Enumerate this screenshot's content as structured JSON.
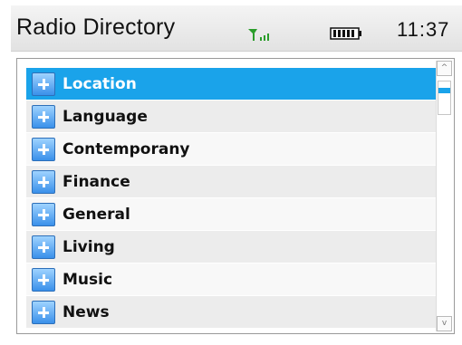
{
  "status_bar": {
    "title": "Radio Directory",
    "signal_icon": "signal-strength-icon",
    "battery_icon": "battery-icon",
    "time": "11:37",
    "signal_color": "#2a9d2a"
  },
  "list": {
    "selected_index": 0,
    "accent_color": "#1aa3ea",
    "items": [
      {
        "label": "Location",
        "icon": "plus-expand-icon"
      },
      {
        "label": "Language",
        "icon": "plus-expand-icon"
      },
      {
        "label": "Contemporany",
        "icon": "plus-expand-icon"
      },
      {
        "label": "Finance",
        "icon": "plus-expand-icon"
      },
      {
        "label": "General",
        "icon": "plus-expand-icon"
      },
      {
        "label": "Living",
        "icon": "plus-expand-icon"
      },
      {
        "label": "Music",
        "icon": "plus-expand-icon"
      },
      {
        "label": "News",
        "icon": "plus-expand-icon"
      }
    ]
  },
  "scrollbar": {
    "up_icon": "scroll-up-arrow-icon",
    "down_icon": "scroll-down-arrow-icon",
    "up_glyph": "^",
    "down_glyph": "v"
  }
}
